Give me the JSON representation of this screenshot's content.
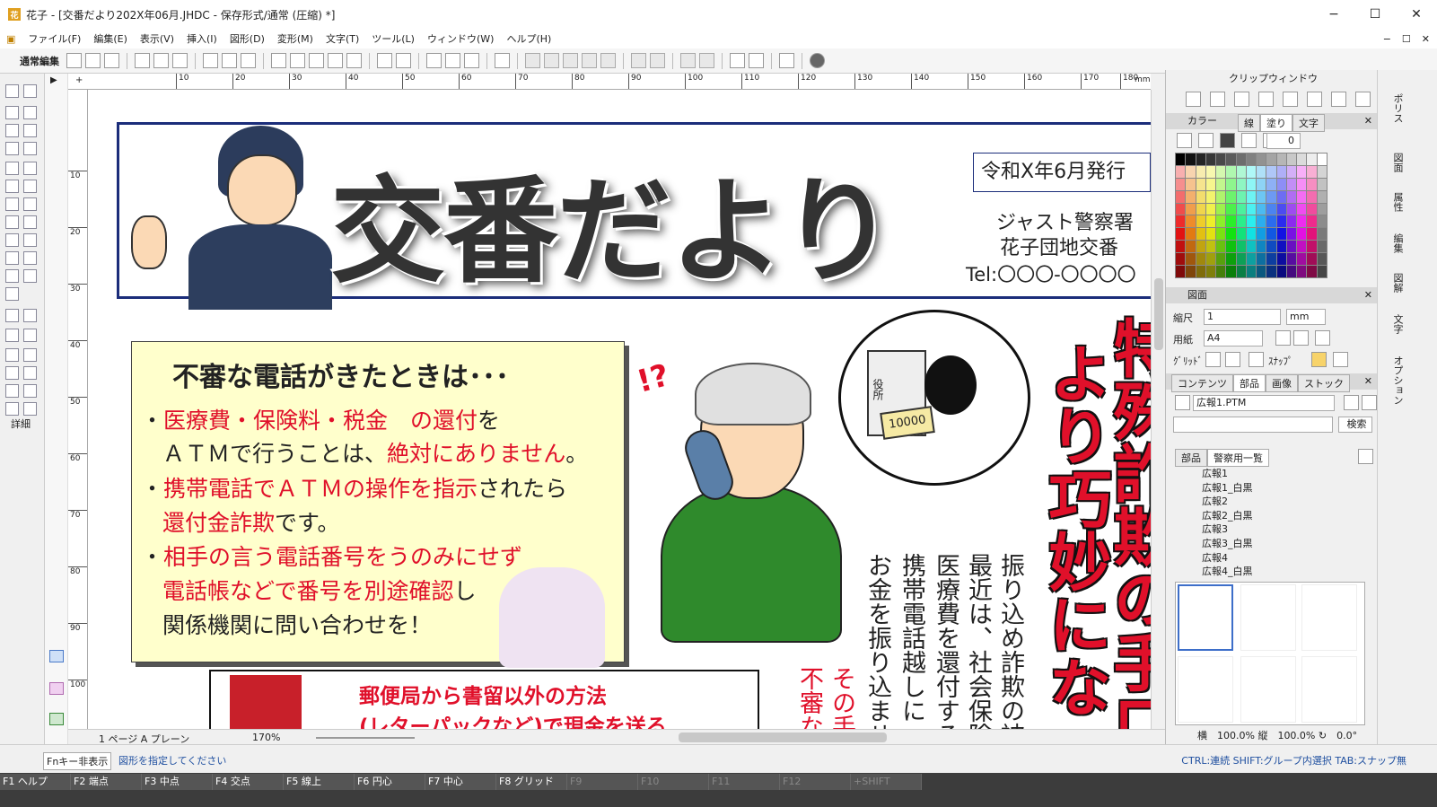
{
  "window": {
    "title": "花子 - [交番だより202X年06月.JHDC - 保存形式/通常 (圧縮) *]",
    "app_icon": "花",
    "controls": [
      "−",
      "☐",
      "✕"
    ]
  },
  "menu": {
    "items": [
      "ファイル(F)",
      "編集(E)",
      "表示(V)",
      "挿入(I)",
      "図形(D)",
      "変形(M)",
      "文字(T)",
      "ツール(L)",
      "ウィンドウ(W)",
      "ヘルプ(H)"
    ],
    "doc_controls": [
      "−",
      "☐",
      "✕"
    ]
  },
  "toolbar": {
    "mode_label": "通常編集"
  },
  "left_tools": {
    "detail_label": "詳細"
  },
  "ruler": {
    "h_labels": [
      "10",
      "20",
      "30",
      "40",
      "50",
      "60",
      "70",
      "80",
      "90",
      "100",
      "110",
      "120",
      "130",
      "140",
      "150",
      "160",
      "170",
      "180"
    ],
    "h_unit": "mm",
    "v_labels": [
      "10",
      "20",
      "30",
      "40",
      "50",
      "60",
      "70",
      "80",
      "90",
      "100"
    ]
  },
  "document": {
    "title": "交番だより",
    "issue": "令和X年6月発行",
    "office_line1": "ジャスト警察署",
    "office_line2": "花子団地交番",
    "tel": "Tel:〇〇〇-〇〇〇〇",
    "box_title": "不審な電話がきたときは･･･",
    "bullet1_red": "医療費・保険料・税金　の還付",
    "bullet1_black": "を",
    "bullet1b_black": "ＡＴＭで行うことは、",
    "bullet1b_red": "絶対にありません",
    "bullet1b_end": "。",
    "bullet2_red": "携帯電話でＡＴＭの操作を指示",
    "bullet2_black": "されたら",
    "bullet2b_red": "還付金詐欺",
    "bullet2b_black": "です。",
    "bullet3_red": "相手の言う電話番号をうのみにせず",
    "bullet3b_red": "電話帳などで番号を別途確認",
    "bullet3b_black": "し",
    "bullet3c_black": "関係機関に問い合わせを！",
    "bullet_mark": "・",
    "exclaim": "!?",
    "money": "10000",
    "building_sign": "役所",
    "post_line1": "郵便局から書留以外の方法",
    "post_line2": "(レターパックなど)で現金を送る",
    "vertical_col1": "振り込め詐欺の被",
    "vertical_col2": "最近は、社会保険",
    "vertical_col3": "医療費を還付する",
    "vertical_col4": "携帯電話越しに",
    "vertical_col5": "お金を振り込ませ",
    "vertical_red": "その手",
    "vertical_red2": "不審な",
    "big_vertical1": "特殊詐欺の手口",
    "big_vertical2": "より巧妙になって"
  },
  "statusbar": {
    "page": "1 ページ A プレーン",
    "zoom": "170%",
    "fn_toggle": "Fnキー非表示",
    "message": "図形を指定してください",
    "hint": "CTRL:連続 SHIFT:グループ内選択 TAB:スナップ無"
  },
  "fnkeys": [
    {
      "key": "F1",
      "label": "ヘルプ"
    },
    {
      "key": "F2",
      "label": "端点"
    },
    {
      "key": "F3",
      "label": "中点"
    },
    {
      "key": "F4",
      "label": "交点"
    },
    {
      "key": "F5",
      "label": "線上"
    },
    {
      "key": "F6",
      "label": "円心"
    },
    {
      "key": "F7",
      "label": "中心"
    },
    {
      "key": "F8",
      "label": "グリッド"
    },
    {
      "key": "F9",
      "label": ""
    },
    {
      "key": "F10",
      "label": ""
    },
    {
      "key": "F11",
      "label": ""
    },
    {
      "key": "F12",
      "label": ""
    },
    {
      "key": "",
      "label": "+SHIFT"
    }
  ],
  "clip_window": {
    "title": "クリップウィンドウ",
    "color_panel": {
      "title": "カラー",
      "tabs": [
        "線",
        "塗り",
        "文字"
      ],
      "active_tab": "塗り",
      "transparency": "0"
    },
    "figure_panel": {
      "title": "図面",
      "scale_label": "縮尺",
      "scale_value": "1",
      "unit": "mm",
      "paper_label": "用紙",
      "paper_value": "A4",
      "grid_label": "ｸﾞﾘｯﾄﾞ",
      "snap_label": "ｽﾅｯﾌﾟ"
    },
    "contents_panel": {
      "tabs": [
        "コンテンツ",
        "部品",
        "画像",
        "ストック"
      ],
      "active_tab": "部品",
      "file": "広報1.PTM",
      "search_button": "検索",
      "subtabs": [
        "部品",
        "警察用一覧"
      ],
      "active_subtab": "警察用一覧",
      "tree_items": [
        "広報1",
        "広報1_白黒",
        "広報2",
        "広報2_白黒",
        "広報3",
        "広報3_白黒",
        "広報4",
        "広報4_白黒"
      ],
      "footer": "横　100.0% 縦　100.0% ↻　0.0°"
    }
  },
  "far_right_tabs": [
    "ポリス",
    "図面",
    "属性",
    "編集",
    "図解",
    "文字",
    "オプション"
  ],
  "colors": {
    "accent_blue": "#1b2d7a",
    "alert_red": "#e0102a",
    "highlight_yellow": "#ffffcc",
    "selection_blue": "#3d6ec9"
  }
}
